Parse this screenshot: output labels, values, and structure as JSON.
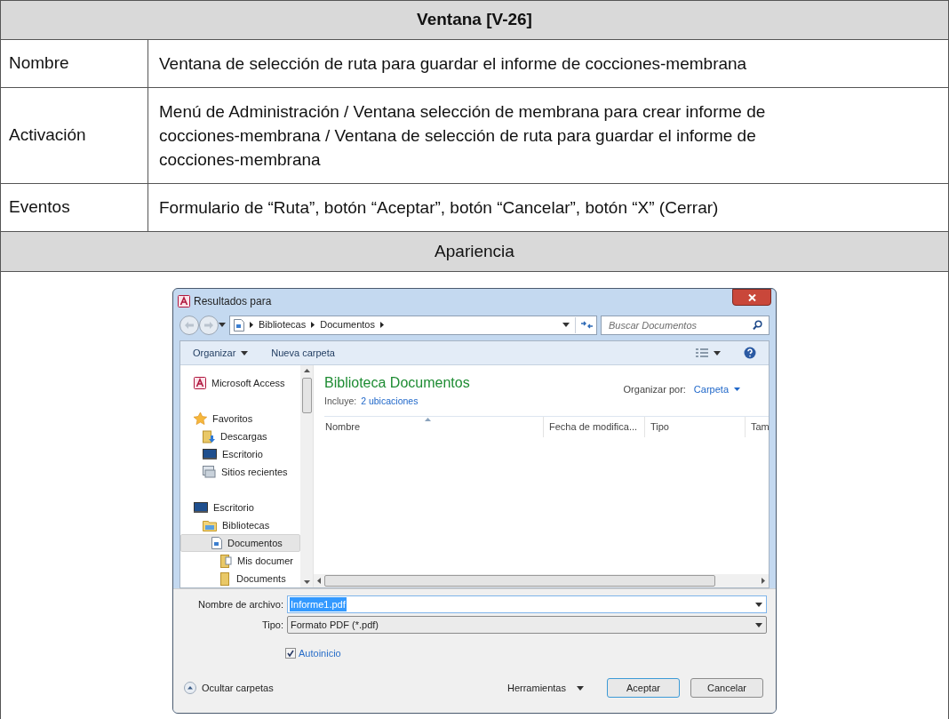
{
  "document_table": {
    "title": "Ventana [V-26]",
    "rows": [
      {
        "label": "Nombre",
        "value": "Ventana de selección de ruta para guardar el informe de cocciones-membrana"
      },
      {
        "label": "Activación",
        "value": "Menú de Administración / Ventana selección de membrana para crear informe de cocciones-membrana / Ventana de selección de ruta para guardar el informe de cocciones-membrana"
      },
      {
        "label": "Eventos",
        "value": "Formulario de “Ruta”, botón “Aceptar”, botón “Cancelar”, botón “X” (Cerrar)"
      }
    ],
    "appearance_heading": "Apariencia"
  },
  "dialog": {
    "title": "Resultados para",
    "breadcrumbs": [
      "Bibliotecas",
      "Documentos"
    ],
    "search": {
      "placeholder": "Buscar Documentos"
    },
    "toolbar": [
      {
        "label": "Organizar",
        "kind": "menu"
      },
      {
        "label": "Nueva carpeta",
        "kind": "button"
      }
    ],
    "nav": [
      {
        "label": "Microsoft Access",
        "kind": "access",
        "selected": false
      },
      {
        "label": "Favoritos",
        "kind": "star",
        "selected": false,
        "children": [
          {
            "label": "Descargas",
            "kind": "download",
            "selected": false
          },
          {
            "label": "Escritorio",
            "kind": "desktop",
            "selected": false
          },
          {
            "label": "Sitios recientes",
            "kind": "recent",
            "selected": false
          }
        ]
      },
      {
        "label": "Escritorio",
        "kind": "desktop",
        "selected": false,
        "children": [
          {
            "label": "Bibliotecas",
            "kind": "library",
            "selected": false,
            "children": [
              {
                "label": "Documentos",
                "kind": "document",
                "selected": true,
                "children": [
                  {
                    "label": "Mis documer",
                    "kind": "folderdoc",
                    "selected": false
                  },
                  {
                    "label": "Documents",
                    "kind": "folder",
                    "selected": false
                  }
                ]
              }
            ]
          }
        ]
      }
    ],
    "library": {
      "heading": "Biblioteca Documentos",
      "includes_label": "Incluye:",
      "includes_link": "2 ubicaciones",
      "arrange_label": "Organizar por:",
      "arrange_value": "Carpeta"
    },
    "columns": [
      "Nombre",
      "Fecha de modifica...",
      "Tipo",
      "Tam"
    ],
    "filename": {
      "label": "Nombre de archivo:",
      "value": "Informe1.pdf"
    },
    "filetype": {
      "label": "Tipo:",
      "value": "Formato PDF (*.pdf)"
    },
    "autostart": {
      "label": "Autoinicio",
      "checked": true
    },
    "hide_folders": "Ocultar carpetas",
    "tools": "Herramientas",
    "buttons": [
      {
        "label": "Aceptar",
        "default": true
      },
      {
        "label": "Cancelar",
        "default": false
      }
    ]
  }
}
